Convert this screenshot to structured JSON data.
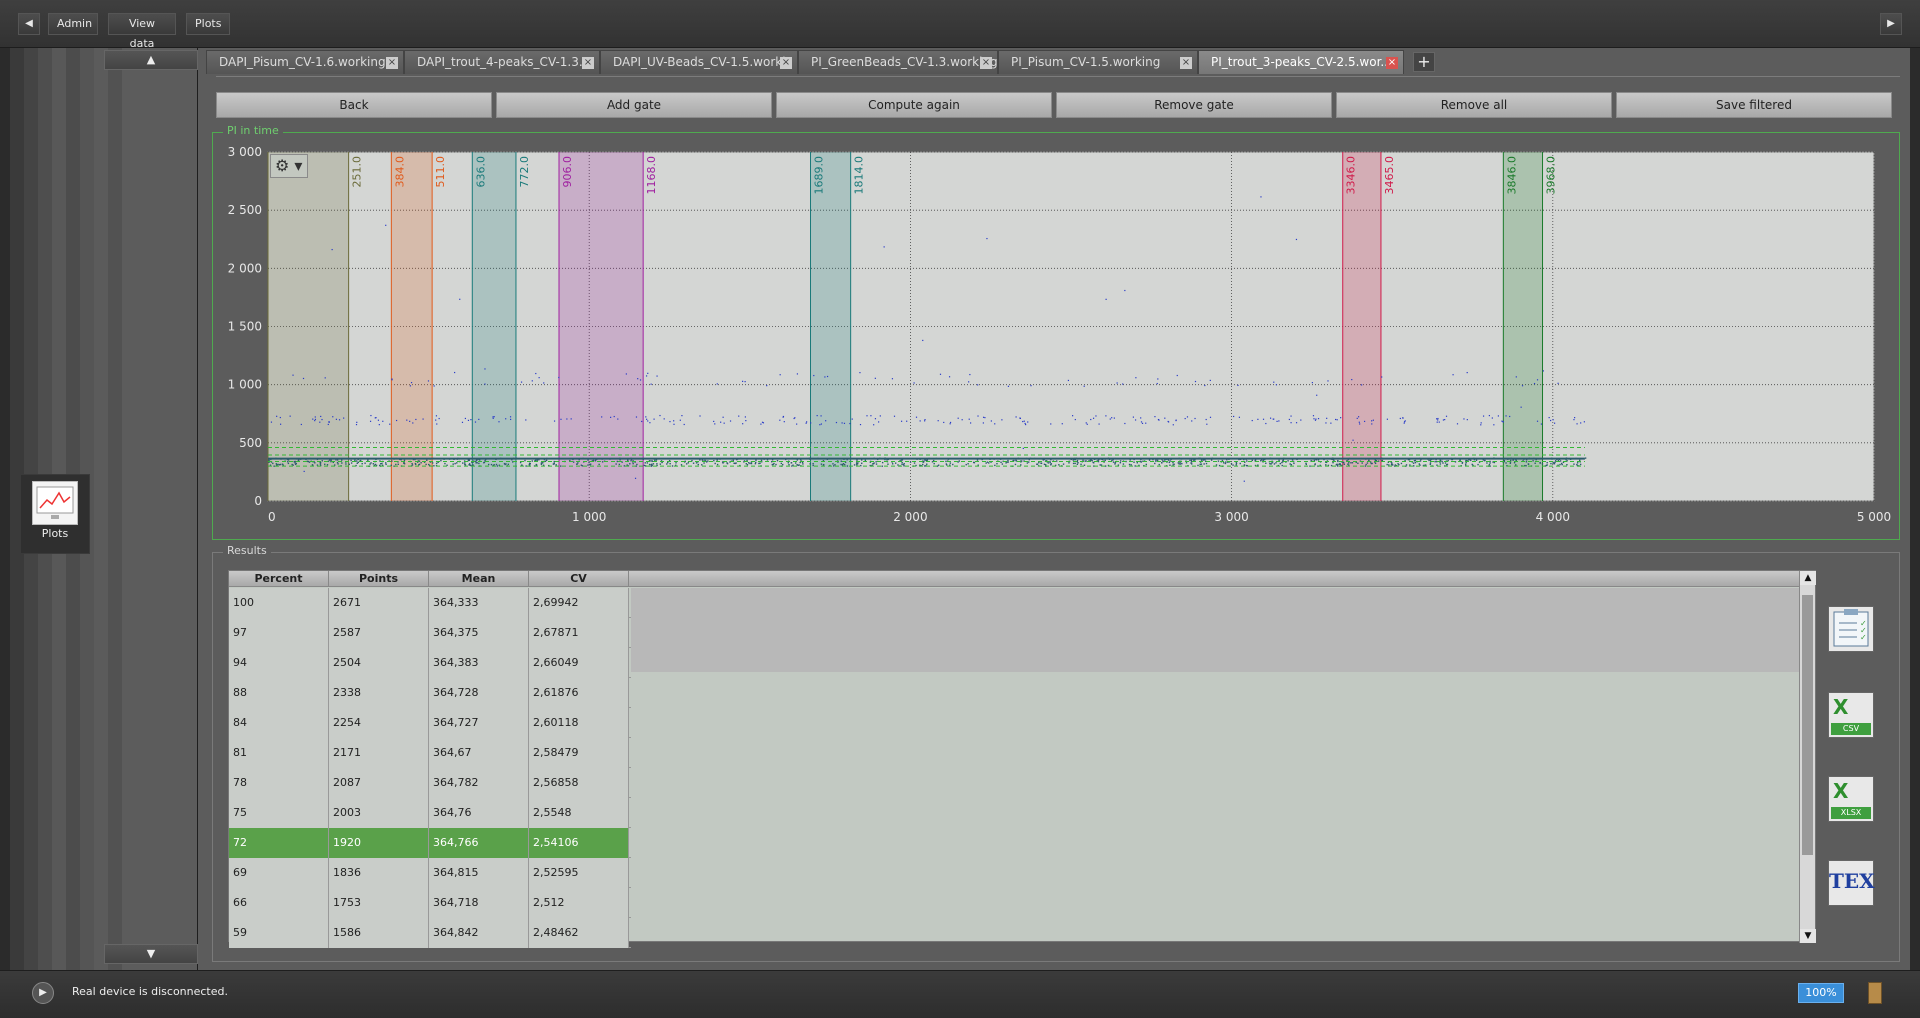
{
  "topbar": {
    "back_arrow": "◀",
    "forward_arrow": "▶",
    "buttons": [
      "Admin",
      "View data",
      "Plots"
    ]
  },
  "leftpanel": {
    "scroll_up": "▲",
    "scroll_down": "▼",
    "app_label": "Plots"
  },
  "tabs": [
    {
      "label": "DAPI_Pisum_CV-1.6.working",
      "active": false
    },
    {
      "label": "DAPI_trout_4-peaks_CV-1.3....",
      "active": false
    },
    {
      "label": "DAPI_UV-Beads_CV-1.5.worki..",
      "active": false
    },
    {
      "label": "PI_GreenBeads_CV-1.3.working",
      "active": false
    },
    {
      "label": "PI_Pisum_CV-1.5.working",
      "active": false
    },
    {
      "label": "PI_trout_3-peaks_CV-2.5.wor...",
      "active": true
    }
  ],
  "tab_close": "×",
  "tab_add": "+",
  "toolbar": {
    "buttons": [
      "Back",
      "Add gate",
      "Compute again",
      "Remove gate",
      "Remove all",
      "Save filtered"
    ]
  },
  "plot_group_title": "PI in time",
  "results_group_title": "Results",
  "chart_data": {
    "type": "scatter",
    "title": "PI in time",
    "xlim": [
      0,
      5000
    ],
    "ylim": [
      0,
      3000
    ],
    "x_ticks": [
      0,
      1000,
      2000,
      3000,
      4000,
      5000
    ],
    "x_tick_labels": [
      "0",
      "1 000",
      "2 000",
      "3 000",
      "4 000",
      "5 000"
    ],
    "y_ticks": [
      0,
      500,
      1000,
      1500,
      2000,
      2500,
      3000
    ],
    "y_tick_labels": [
      "0",
      "500",
      "1 000",
      "1 500",
      "2 000",
      "2 500",
      "3 000"
    ],
    "grid": true,
    "point_color": "#2a3cc7",
    "main_band": {
      "center": 364,
      "range": [
        300,
        450
      ],
      "x_range": [
        0,
        4100
      ],
      "color": "#2d5c6c"
    },
    "threshold_lines": [
      300,
      340,
      395,
      460
    ],
    "threshold_color": "#33b833",
    "gates": [
      {
        "from": 0,
        "to": 251,
        "labels": [
          "251.0"
        ],
        "color": "#6b6b3a"
      },
      {
        "from": 384,
        "to": 511,
        "labels": [
          "384.0",
          "511.0"
        ],
        "color": "#e05a1c"
      },
      {
        "from": 636,
        "to": 772,
        "labels": [
          "636.0",
          "772.0"
        ],
        "color": "#1a7a7a"
      },
      {
        "from": 906,
        "to": 1168,
        "labels": [
          "906.0",
          "1168.0"
        ],
        "color": "#a020a0"
      },
      {
        "from": 1689,
        "to": 1814,
        "labels": [
          "1689.0",
          "1814.0"
        ],
        "color": "#1a7a7a"
      },
      {
        "from": 3346,
        "to": 3465,
        "labels": [
          "3346.0",
          "3465.0"
        ],
        "color": "#d01a4a"
      },
      {
        "from": 3846,
        "to": 3968,
        "labels": [
          "3846.0",
          "3968.0"
        ],
        "color": "#1a7a2a"
      }
    ]
  },
  "table": {
    "columns": [
      "Percent",
      "Points",
      "Mean",
      "CV"
    ],
    "rows": [
      [
        "100",
        "2671",
        "364,333",
        "2,69942"
      ],
      [
        "97",
        "2587",
        "364,375",
        "2,67871"
      ],
      [
        "94",
        "2504",
        "364,383",
        "2,66049"
      ],
      [
        "88",
        "2338",
        "364,728",
        "2,61876"
      ],
      [
        "84",
        "2254",
        "364,727",
        "2,60118"
      ],
      [
        "81",
        "2171",
        "364,67",
        "2,58479"
      ],
      [
        "78",
        "2087",
        "364,782",
        "2,56858"
      ],
      [
        "75",
        "2003",
        "364,76",
        "2,5548"
      ],
      [
        "72",
        "1920",
        "364,766",
        "2,54106"
      ],
      [
        "69",
        "1836",
        "364,815",
        "2,52595"
      ],
      [
        "66",
        "1753",
        "364,718",
        "2,512"
      ],
      [
        "59",
        "1586",
        "364,842",
        "2,48462"
      ]
    ],
    "selected_row": 8
  },
  "export": {
    "csv_label": "CSV",
    "xlsx_label": "XLSX",
    "tex_label": "TEX"
  },
  "status": {
    "message": "Real device is disconnected.",
    "zoom": "100%"
  }
}
